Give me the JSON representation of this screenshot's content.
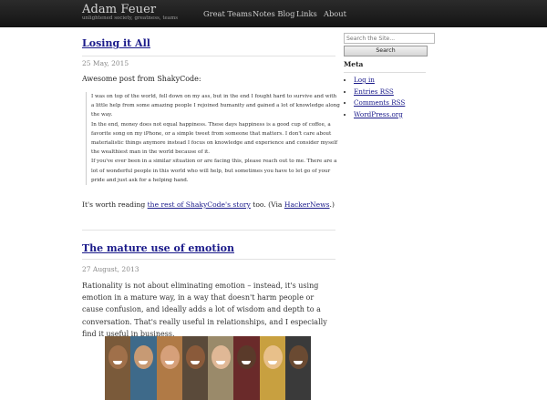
{
  "site": {
    "name": "Adam Feuer",
    "tagline": "unlightened society, greatness, teams"
  },
  "nav": [
    "Great Teams",
    "Notes Blog",
    "Links",
    "About"
  ],
  "posts": [
    {
      "title": "Losing it All",
      "date": "25 May, 2015",
      "intro": "Awesome post from ShakyCode:",
      "quote": [
        "I was on top of the world, fell down on my ass, but in the end I fought hard to survive and with a little help from some amazing people I rejoined humanity and gained a lot of knowledge along the way.",
        "In the end, money does not equal happiness. These days happiness is a good cup of coffee, a favorite song on my iPhone, or a simple tweet from someone that matters. I don't care about materialistic things anymore instead I focus on knowledge and experience and consider myself the wealthiest man in the world because of it.",
        "If you've ever been in a similar situation or are facing this, please reach out to me. There are a lot of wonderful people in this world who will help, but sometimes you have to let go of your pride and just ask for a helping hand."
      ],
      "outro_prefix": "It's worth reading ",
      "outro_link": "the rest of ShakyCode's story",
      "outro_mid": " too. (Via ",
      "outro_link2": "HackerNews",
      "outro_suffix": ".)"
    },
    {
      "title": "The mature use of emotion",
      "date": "27 August, 2013",
      "body": "Rationality is not about eliminating emotion – instead, it's using emotion in a mature way, in a way that doesn't harm people or cause confusion, and ideally adds a lot of wisdom and depth to a conversation. That's really useful in relationships, and I especially find it useful in business."
    }
  ],
  "sidebar": {
    "search_placeholder": "Search the Site...",
    "search_button": "Search",
    "meta_heading": "Meta",
    "meta_links": [
      "Log in",
      "Entries RSS",
      "Comments RSS",
      "WordPress.org"
    ]
  },
  "faces": [
    {
      "bg": "#7a5a3a",
      "skin": "#a0704a"
    },
    {
      "bg": "#3e6a8a",
      "skin": "#c79a74"
    },
    {
      "bg": "#b07a46",
      "skin": "#d6a07a"
    },
    {
      "bg": "#5a4a3a",
      "skin": "#8a5a3a"
    },
    {
      "bg": "#9a8a6a",
      "skin": "#e0b896"
    },
    {
      "bg": "#6a2a2a",
      "skin": "#5a3a2a"
    },
    {
      "bg": "#c8a040",
      "skin": "#e8c08a"
    },
    {
      "bg": "#3a3a3a",
      "skin": "#6a4a32"
    }
  ]
}
